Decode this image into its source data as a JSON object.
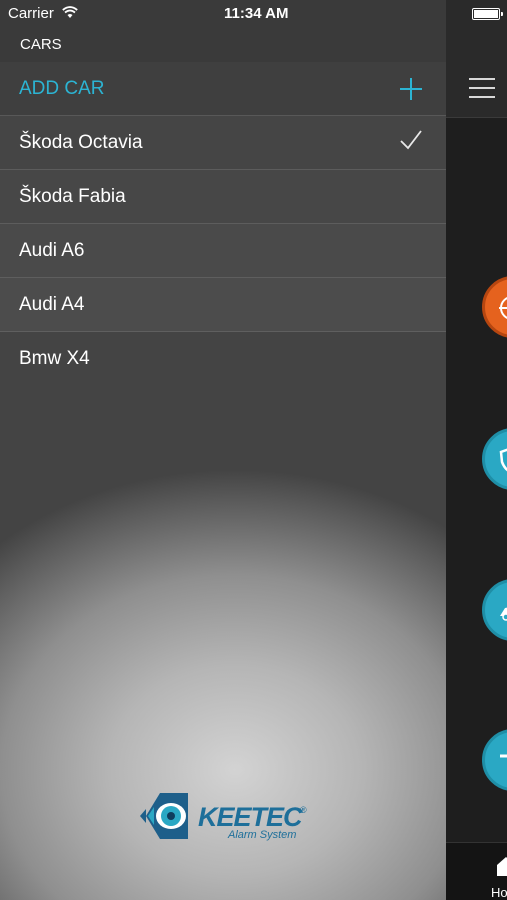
{
  "status_bar": {
    "carrier": "Carrier",
    "time": "11:34 AM"
  },
  "drawer": {
    "section_title": "CARS",
    "add_car_label": "ADD CAR",
    "cars": [
      {
        "name": "Škoda Octavia",
        "selected": true
      },
      {
        "name": "Škoda Fabia",
        "selected": false
      },
      {
        "name": "Audi A6",
        "selected": false
      },
      {
        "name": "Audi A4",
        "selected": false
      },
      {
        "name": "Bmw X4",
        "selected": false
      }
    ],
    "logo": {
      "brand": "KEETEC",
      "tagline": "Alarm System"
    }
  },
  "main": {
    "bottom_tab_label": "Ho",
    "feature_icons": [
      "target-icon",
      "shield-icon",
      "car-icon",
      "trunk-icon"
    ]
  },
  "colors": {
    "accent": "#2cb4d3",
    "orange": "#e5621e",
    "teal": "#2aa8c4"
  }
}
